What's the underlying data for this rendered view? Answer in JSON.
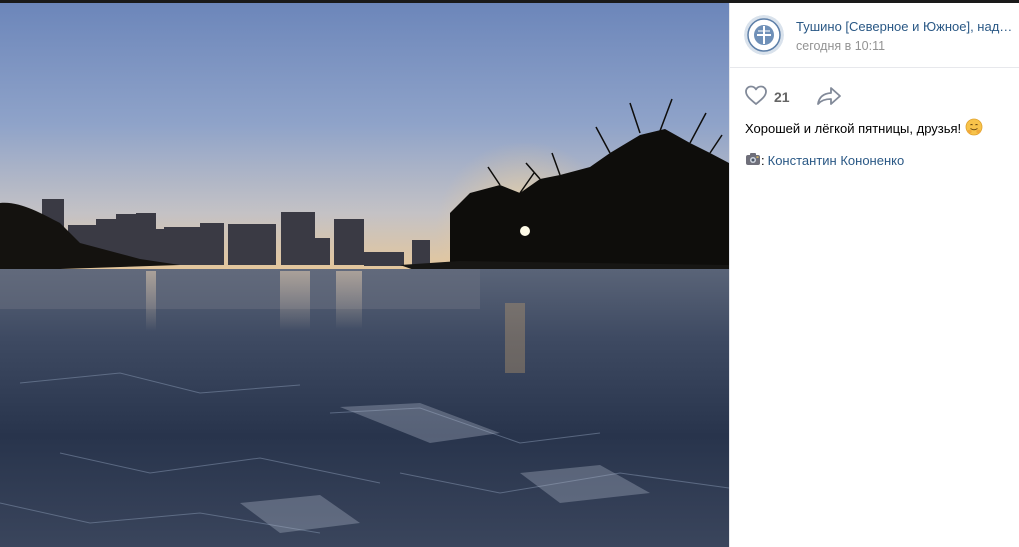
{
  "post": {
    "author": "Тушино [Северное и Южное], надежда на лучшее",
    "date": "сегодня в 10:11",
    "likes": "21",
    "caption": "Хорошей и лёгкой пятницы, друзья!",
    "caption_emoji_icon": "smiling-face-with-hands-icon",
    "photo_credit_icon": "camera-icon",
    "photo_credit_separator": ":",
    "photo_credit_name": "Константин Кононенко"
  },
  "colors": {
    "link": "#2a5885",
    "muted": "#939393",
    "icon": "#828a99",
    "divider": "#e7e8ec"
  }
}
